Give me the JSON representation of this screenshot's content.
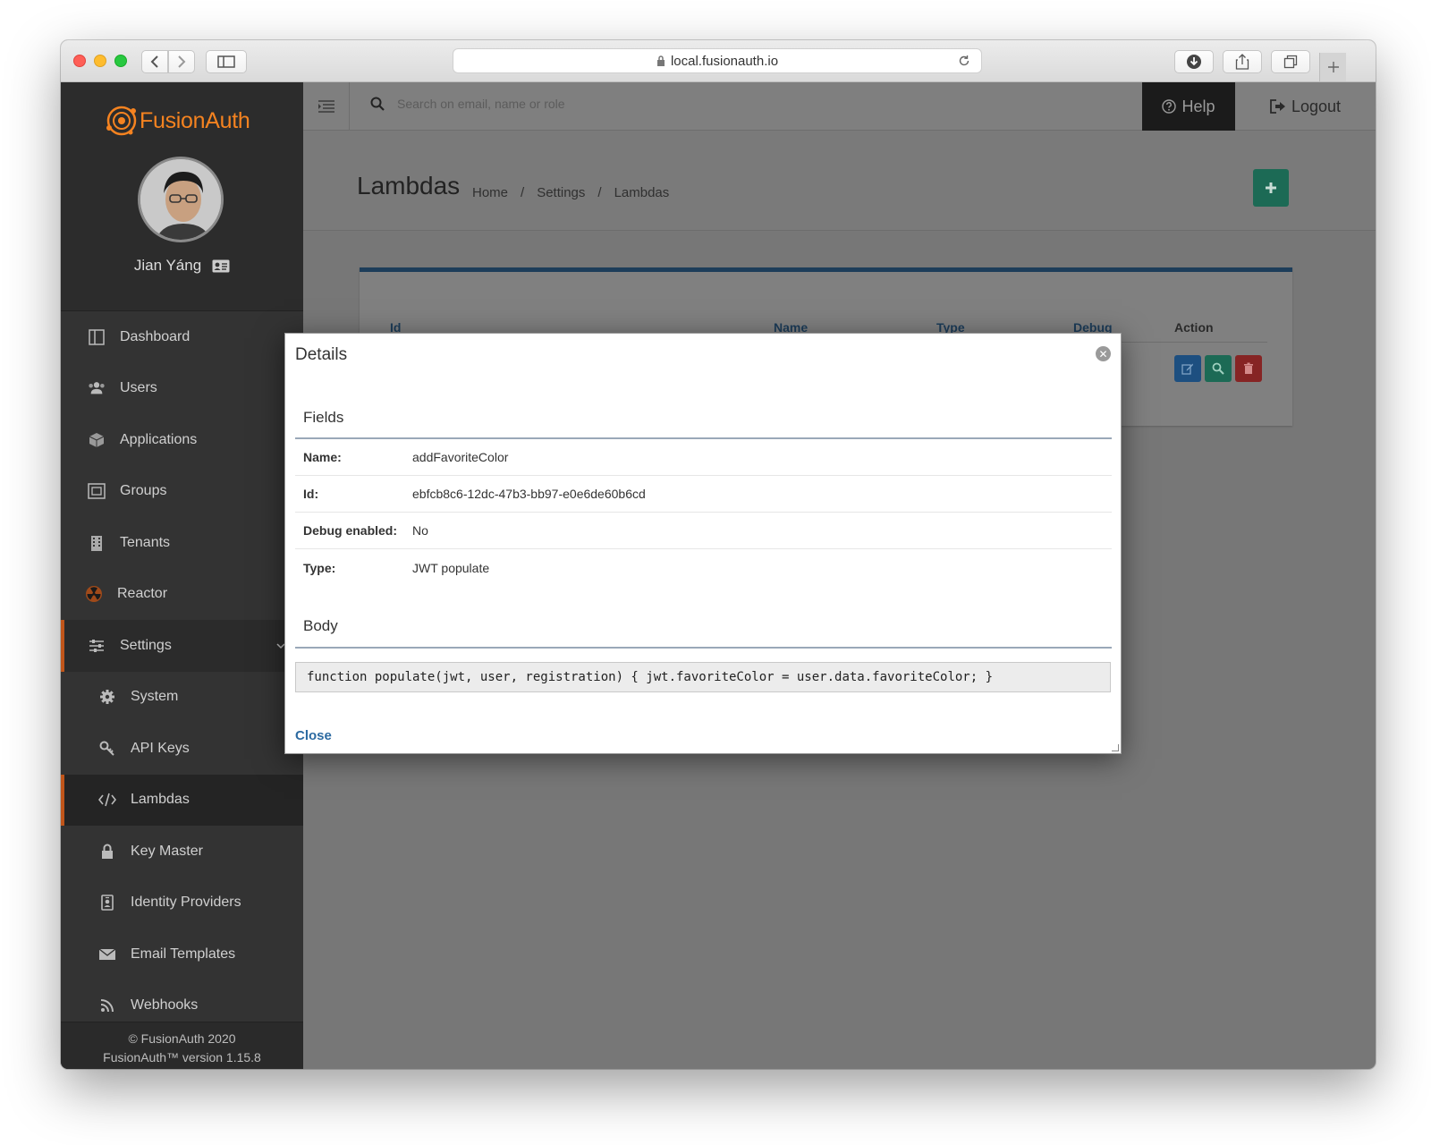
{
  "browser": {
    "url": "local.fusionauth.io",
    "back_icon": "chevron-left-icon",
    "forward_icon": "chevron-right-icon",
    "sidebar_toggle_icon": "sidebar-icon",
    "lock_icon": "lock-icon",
    "reload_icon": "reload-icon",
    "download_icon": "download-icon",
    "share_icon": "share-icon",
    "tabs_icon": "tabs-icon",
    "new_tab_icon": "plus-icon"
  },
  "brand": {
    "name": "FusionAuth",
    "accent": "#f58320"
  },
  "user": {
    "name": "Jian Yáng"
  },
  "sidebar": {
    "items": [
      {
        "label": "Dashboard",
        "icon": "dashboard-icon"
      },
      {
        "label": "Users",
        "icon": "users-icon"
      },
      {
        "label": "Applications",
        "icon": "cube-icon"
      },
      {
        "label": "Groups",
        "icon": "groups-icon"
      },
      {
        "label": "Tenants",
        "icon": "building-icon"
      },
      {
        "label": "Reactor",
        "icon": "radiation-icon"
      },
      {
        "label": "Settings",
        "icon": "sliders-icon"
      },
      {
        "label": "System",
        "icon": "gear-icon"
      },
      {
        "label": "API Keys",
        "icon": "key-icon"
      },
      {
        "label": "Lambdas",
        "icon": "code-icon"
      },
      {
        "label": "Key Master",
        "icon": "lock-icon"
      },
      {
        "label": "Identity Providers",
        "icon": "id-badge-icon"
      },
      {
        "label": "Email Templates",
        "icon": "envelope-icon"
      },
      {
        "label": "Webhooks",
        "icon": "rss-icon"
      }
    ],
    "footer_line1": "© FusionAuth 2020",
    "footer_line2": "FusionAuth™ version 1.15.8"
  },
  "topbar": {
    "search_placeholder": "Search on email, name or role",
    "help_label": "Help",
    "logout_label": "Logout"
  },
  "page": {
    "title": "Lambdas",
    "breadcrumbs": [
      "Home",
      "/",
      "Settings",
      "/",
      "Lambdas"
    ]
  },
  "table": {
    "headers": [
      "Id",
      "Name",
      "Type",
      "Debug",
      "Action"
    ],
    "action_colors": {
      "edit": "#1d4f80",
      "view": "#1c6a55",
      "delete": "#862424"
    }
  },
  "modal": {
    "title": "Details",
    "fields_title": "Fields",
    "fields": [
      {
        "label": "Name:",
        "value": "addFavoriteColor"
      },
      {
        "label": "Id:",
        "value": "ebfcb8c6-12dc-47b3-bb97-e0e6de60b6cd"
      },
      {
        "label": "Debug enabled:",
        "value": "No"
      },
      {
        "label": "Type:",
        "value": "JWT populate"
      }
    ],
    "body_title": "Body",
    "body_code": "function populate(jwt, user, registration) { jwt.favoriteColor = user.data.favoriteColor; }",
    "close_label": "Close",
    "link_color": "#2c6aa1"
  }
}
